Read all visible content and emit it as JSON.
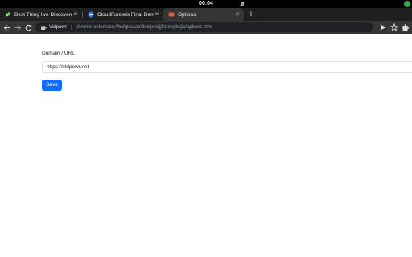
{
  "system": {
    "clock": "00:04"
  },
  "tabs": [
    {
      "title": "Best Thing I've Discovered",
      "icon": "green-leaf-favicon-icon",
      "active": false
    },
    {
      "title": "CloudFunnels Final Demo",
      "icon": "cloudfunnels-favicon-icon",
      "active": false
    },
    {
      "title": "Options",
      "icon": "extension-favicon-icon",
      "active": true
    }
  ],
  "toolbar": {
    "site_name": "Vidpowr",
    "url": "chrome-extension://bcfgkaaaeldnklpelcjjflanlegbkjic/options.html"
  },
  "form": {
    "label": "Domain / URL",
    "value": "https://vidpowr.net",
    "save_label": "Save"
  },
  "colors": {
    "primary": "#0d6efd",
    "tab_bg": "#1f1f1f",
    "active_tab_bg": "#353535"
  }
}
